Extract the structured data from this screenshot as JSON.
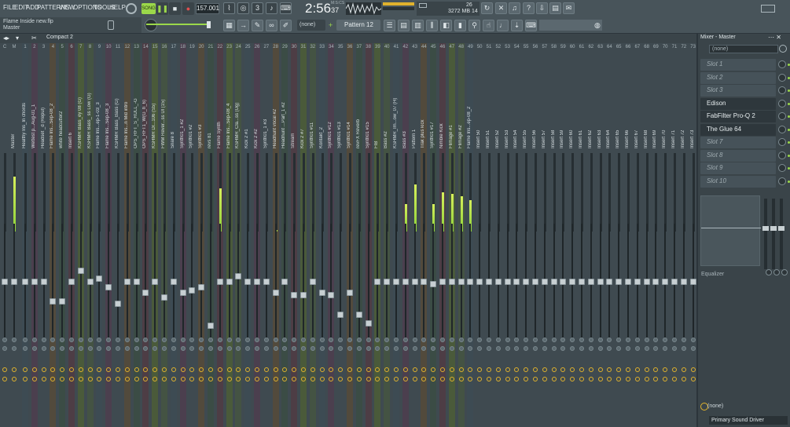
{
  "menu": [
    "FILE",
    "EDIT",
    "ADD",
    "PATTERNS",
    "VIEW",
    "OPTIONS",
    "TOOLS",
    "HELP"
  ],
  "transport": {
    "song_label": "SONG",
    "tempo": "157.001",
    "time": "2:56",
    "time_sub": "37",
    "time_unit": "M:S:CS"
  },
  "cpu": {
    "value": "26",
    "memory": "3272 MB",
    "voices": "14"
  },
  "hint": {
    "project": "Flame Inside new.flp",
    "target": "Master"
  },
  "toolbar": {
    "snap": "(none)",
    "pattern": "Pattern 12"
  },
  "mixer": {
    "view": "Compact 2",
    "strips": [
      {
        "num": "C",
        "name": "",
        "meter": 0,
        "fader": 0.5
      },
      {
        "num": "M",
        "name": "Master",
        "meter": 0.7,
        "fader": 0.5
      },
      {
        "num": "1",
        "name": "Healthy Ins_In chords",
        "meter": 0,
        "fader": 0.5
      },
      {
        "num": "2",
        "name": "Wettest p...Aug-01_1",
        "meter": 0,
        "fader": 0.5
      },
      {
        "num": "3",
        "name": "Headset _d (Repul)",
        "meter": 0,
        "fader": 0.5
      },
      {
        "num": "4",
        "name": "Flame Ins...Sep-08_2",
        "meter": 0,
        "fader": 0.32
      },
      {
        "num": "5",
        "name": "white headcutter2",
        "meter": 0,
        "fader": 0.32
      },
      {
        "num": "6",
        "name": "Insert 6",
        "meter": 0,
        "fader": 0.5
      },
      {
        "num": "7",
        "name": "KSHMR Bass_ey 08 (G)",
        "meter": 0,
        "fader": 0.6
      },
      {
        "num": "8",
        "name": "KSHMR Bass_ ss Low (G)",
        "meter": 0,
        "fader": 0.5
      },
      {
        "num": "9",
        "name": "Flame Ins...ep-1-03_3",
        "meter": 0,
        "fader": 0.53
      },
      {
        "num": "10",
        "name": "Flame Ins...Sep-08_3",
        "meter": 0,
        "fader": 0.45
      },
      {
        "num": "11",
        "name": "KSHMR Bass_Bass (G)",
        "meter": 0,
        "fader": 0.3
      },
      {
        "num": "12",
        "name": "Flame Ins...n Mid intro",
        "meter": 0,
        "fader": 0.5
      },
      {
        "num": "13",
        "name": "OPS_RFT_S_RULL_-G",
        "meter": 0,
        "fader": 0.5
      },
      {
        "num": "14",
        "name": "OPS_RFT1_W(G_h_6)",
        "meter": 0,
        "fader": 0.4
      },
      {
        "num": "15",
        "name": "KSHMR Dr...106 (S5)",
        "meter": 0,
        "fader": 0.5
      },
      {
        "num": "16",
        "name": "FWM Rever...ss Ul (15)",
        "meter": 0,
        "fader": 0.36
      },
      {
        "num": "17",
        "name": "Snare 8",
        "meter": 0,
        "fader": 0.5
      },
      {
        "num": "18",
        "name": "Synth01_1 #2",
        "meter": 0,
        "fader": 0.4
      },
      {
        "num": "19",
        "name": "Synth01 #2",
        "meter": 0,
        "fader": 0.42
      },
      {
        "num": "20",
        "name": "Synth01 #3",
        "meter": 0,
        "fader": 0.45
      },
      {
        "num": "21",
        "name": "revs 81",
        "meter": 0,
        "fader": 0.1
      },
      {
        "num": "22",
        "name": "Flame Synth",
        "meter": 0.55,
        "fader": 0.5
      },
      {
        "num": "23",
        "name": "Flame Ins...Sep-08_4",
        "meter": 0,
        "fader": 0.5
      },
      {
        "num": "24",
        "name": "KSHMR_Cla...ss (Ug)",
        "meter": 0,
        "fader": 0.55
      },
      {
        "num": "25",
        "name": "Kick 2 #1",
        "meter": 0,
        "fader": 0.5
      },
      {
        "num": "26",
        "name": "Kick 2 #2",
        "meter": 0,
        "fader": 0.5
      },
      {
        "num": "27",
        "name": "Synth01_1 #3",
        "meter": 0,
        "fader": 0.5
      },
      {
        "num": "28",
        "name": "Headhunt vocal #2",
        "meter": 0.02,
        "fader": 0.4
      },
      {
        "num": "29",
        "name": "Headhunt ...Part_1 #2",
        "meter": 0,
        "fader": 0.5
      },
      {
        "num": "30",
        "name": "Stream",
        "meter": 0,
        "fader": 0.38
      },
      {
        "num": "31",
        "name": "Kick 2 #7",
        "meter": 0,
        "fader": 0.38
      },
      {
        "num": "32",
        "name": "Synth01 #11",
        "meter": 0,
        "fader": 0.5
      },
      {
        "num": "33",
        "name": "Kontakt_2",
        "meter": 0,
        "fader": 0.4
      },
      {
        "num": "34",
        "name": "Synth01 #12",
        "meter": 0,
        "fader": 0.38
      },
      {
        "num": "35",
        "name": "Synth01 #13",
        "meter": 0,
        "fader": 0.2
      },
      {
        "num": "36",
        "name": "Synth01 #14",
        "meter": 0,
        "fader": 0.4
      },
      {
        "num": "37",
        "name": "revFX Reverb",
        "meter": 0,
        "fader": 0.2
      },
      {
        "num": "38",
        "name": "Synth01 #15",
        "meter": 0,
        "fader": 0.12
      },
      {
        "num": "39",
        "name": "FIB",
        "meter": 0,
        "fader": 0.5
      },
      {
        "num": "40",
        "name": "Bass #2",
        "meter": 0,
        "fader": 0.5
      },
      {
        "num": "41",
        "name": "KSHMR_Im...ow_07 (H)",
        "meter": 0,
        "fader": 0.5
      },
      {
        "num": "42",
        "name": "Bass #3",
        "meter": 0.35,
        "fader": 0.5
      },
      {
        "num": "43",
        "name": "Pattern 1",
        "meter": 0.6,
        "fader": 0.5
      },
      {
        "num": "44",
        "name": "Trak plus kick",
        "meter": 0,
        "fader": 0.5
      },
      {
        "num": "45",
        "name": "Synth01 #17",
        "meter": 0.35,
        "fader": 0.48
      },
      {
        "num": "46",
        "name": "Nimble Kick",
        "meter": 0.5,
        "fader": 0.5
      },
      {
        "num": "47",
        "name": "Flimage #1",
        "meter": 0.48,
        "fader": 0.5
      },
      {
        "num": "48",
        "name": "Flimage #2",
        "meter": 0.45,
        "fader": 0.5
      },
      {
        "num": "49",
        "name": "Flame Ins...ep-08_2",
        "meter": 0.4,
        "fader": 0.5
      },
      {
        "num": "50",
        "name": "Insert 50",
        "meter": 0,
        "fader": 0.5
      },
      {
        "num": "51",
        "name": "Insert 51",
        "meter": 0,
        "fader": 0.5
      },
      {
        "num": "52",
        "name": "Insert 52",
        "meter": 0,
        "fader": 0.5
      },
      {
        "num": "53",
        "name": "Insert 53",
        "meter": 0,
        "fader": 0.5
      },
      {
        "num": "54",
        "name": "Insert 54",
        "meter": 0,
        "fader": 0.5
      },
      {
        "num": "55",
        "name": "Insert 55",
        "meter": 0,
        "fader": 0.5
      },
      {
        "num": "56",
        "name": "Insert 56",
        "meter": 0,
        "fader": 0.5
      },
      {
        "num": "57",
        "name": "Insert 57",
        "meter": 0,
        "fader": 0.5
      },
      {
        "num": "58",
        "name": "Insert 58",
        "meter": 0,
        "fader": 0.5
      },
      {
        "num": "59",
        "name": "Insert 59",
        "meter": 0,
        "fader": 0.5
      },
      {
        "num": "60",
        "name": "Insert 60",
        "meter": 0,
        "fader": 0.5
      },
      {
        "num": "61",
        "name": "Insert 61",
        "meter": 0,
        "fader": 0.5
      },
      {
        "num": "62",
        "name": "Insert 62",
        "meter": 0,
        "fader": 0.5
      },
      {
        "num": "63",
        "name": "Insert 63",
        "meter": 0,
        "fader": 0.5
      },
      {
        "num": "64",
        "name": "Insert 64",
        "meter": 0,
        "fader": 0.5
      },
      {
        "num": "65",
        "name": "Insert 65",
        "meter": 0,
        "fader": 0.5
      },
      {
        "num": "66",
        "name": "Insert 66",
        "meter": 0,
        "fader": 0.5
      },
      {
        "num": "67",
        "name": "Insert 67",
        "meter": 0,
        "fader": 0.5
      },
      {
        "num": "68",
        "name": "Insert 68",
        "meter": 0,
        "fader": 0.5
      },
      {
        "num": "69",
        "name": "Insert 69",
        "meter": 0,
        "fader": 0.5
      },
      {
        "num": "70",
        "name": "Insert 70",
        "meter": 0,
        "fader": 0.5
      },
      {
        "num": "71",
        "name": "Insert 71",
        "meter": 0,
        "fader": 0.5
      },
      {
        "num": "72",
        "name": "Insert 72",
        "meter": 0,
        "fader": 0.5
      },
      {
        "num": "73",
        "name": "Insert 73",
        "meter": 0,
        "fader": 0.5
      },
      {
        "num": "74",
        "name": "Insert 74",
        "meter": 0,
        "fader": 0.5
      }
    ]
  },
  "right_panel": {
    "title": "Mixer - Master",
    "input": "(none)",
    "slots": [
      {
        "label": "Slot 1",
        "active": false
      },
      {
        "label": "Slot 2",
        "active": false
      },
      {
        "label": "Slot 3",
        "active": false
      },
      {
        "label": "Edison",
        "active": true
      },
      {
        "label": "FabFilter Pro-Q 2",
        "active": true
      },
      {
        "label": "The Glue 64",
        "active": true
      },
      {
        "label": "Slot 7",
        "active": false
      },
      {
        "label": "Slot 8",
        "active": false
      },
      {
        "label": "Slot 9",
        "active": false
      },
      {
        "label": "Slot 10",
        "active": false
      }
    ],
    "eq_label": "Equalizer",
    "output_none": "(none)",
    "output_device": "Primary Sound Driver"
  },
  "colors": {
    "accent": "#9bd84a",
    "bg": "#3f4a50"
  }
}
